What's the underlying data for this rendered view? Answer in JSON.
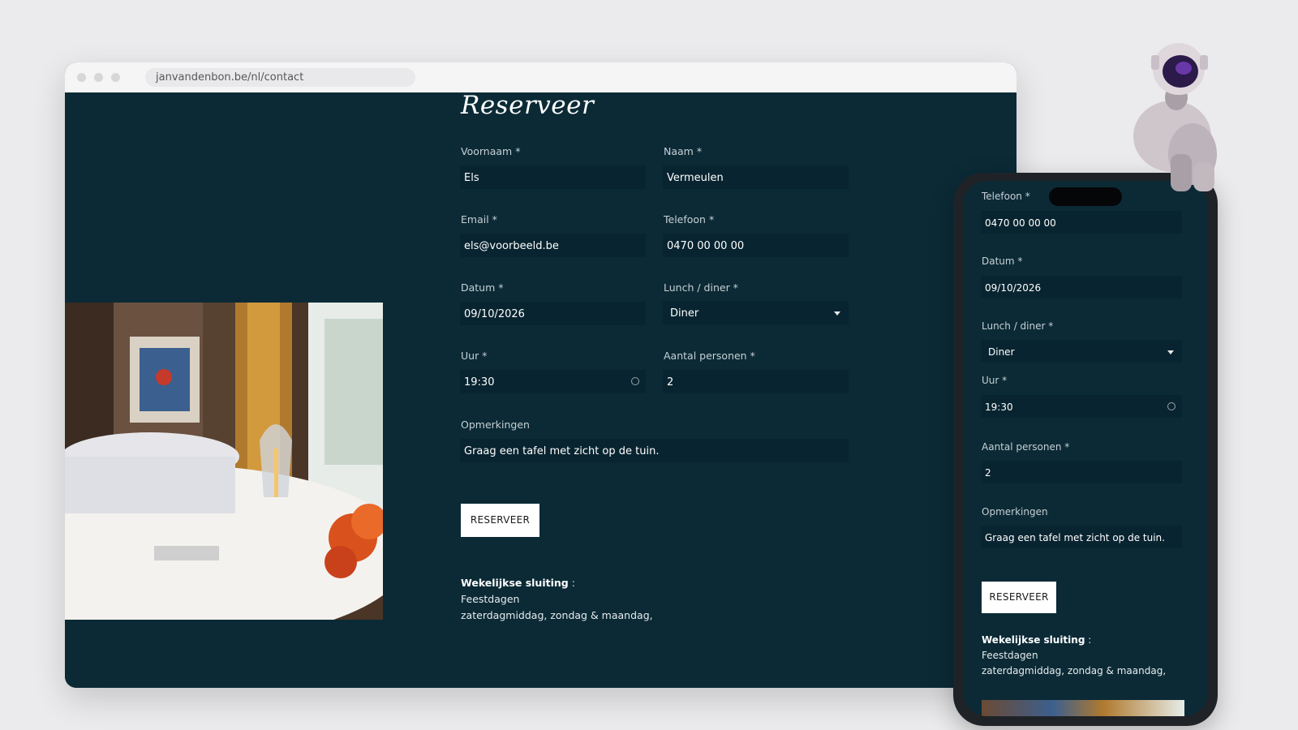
{
  "browser": {
    "url": "janvandenbon.be/nl/contact"
  },
  "page": {
    "title": "Reserveer"
  },
  "form": {
    "voornaam": {
      "label": "Voornaam *",
      "value": "Els"
    },
    "naam": {
      "label": "Naam *",
      "value": "Vermeulen"
    },
    "email": {
      "label": "Email *",
      "value": "els@voorbeeld.be"
    },
    "telefoon": {
      "label": "Telefoon *",
      "value": "0470 00 00 00"
    },
    "datum": {
      "label": "Datum *",
      "value": "09/10/2026"
    },
    "lunch_diner": {
      "label": "Lunch / diner *",
      "value": "Diner"
    },
    "uur": {
      "label": "Uur *",
      "value": "19:30"
    },
    "aantal": {
      "label": "Aantal personen *",
      "value": "2"
    },
    "opmerkingen": {
      "label": "Opmerkingen",
      "value": "Graag een tafel met zicht op de tuin."
    },
    "submit_label": "RESERVEER"
  },
  "closing": {
    "heading": "Wekelijkse sluiting",
    "sep": ":",
    "line1": "Feestdagen",
    "line2": "zaterdagmiddag, zondag & maandag,"
  },
  "icons": {
    "select": "chevron-down-icon",
    "time": "clock-icon"
  },
  "colors": {
    "background": "#0b2a36",
    "input": "#082430",
    "button": "#ffffff"
  }
}
